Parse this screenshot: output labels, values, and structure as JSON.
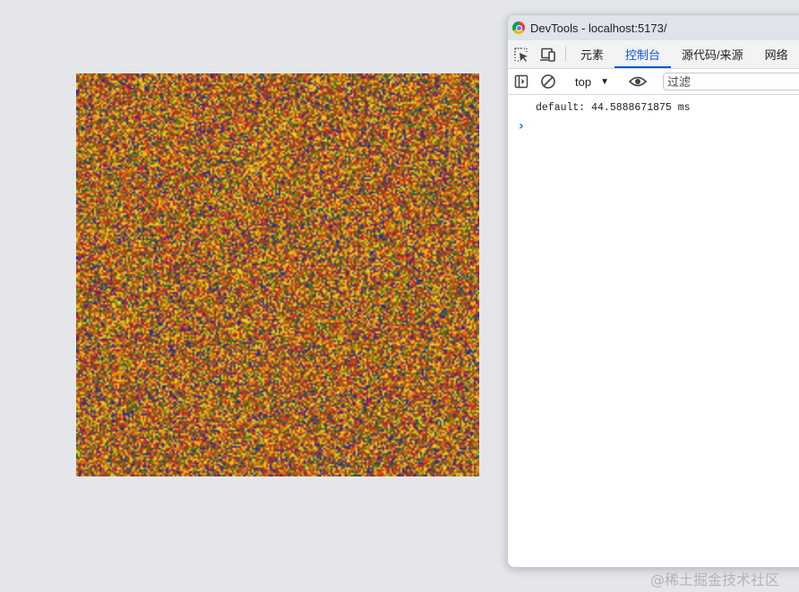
{
  "window": {
    "title": "DevTools - localhost:5173/"
  },
  "tabs": [
    {
      "label": "元素"
    },
    {
      "label": "控制台",
      "active": true
    },
    {
      "label": "源代码/来源"
    },
    {
      "label": "网络"
    }
  ],
  "toolbar": {
    "context": "top",
    "filter_placeholder": "过滤"
  },
  "console": {
    "lines": [
      "default: 44.5888671875 ms"
    ]
  },
  "icons": {
    "inspect": "inspect-element-icon",
    "device": "device-toolbar-icon",
    "sidebar": "show-sidebar-icon",
    "clear": "clear-console-icon",
    "live_expression": "eye-icon",
    "prompt": "chevron-right-icon"
  },
  "colors": {
    "page_background": "#e4e6ea",
    "active_tab": "#0b57d0",
    "prompt": "#1a73e8",
    "noise_palette": [
      "#c8321e",
      "#e0a818",
      "#f0d020",
      "#2a2a96",
      "#3a6e1e",
      "#e06a1a",
      "#b42830",
      "#8a7a1a"
    ]
  },
  "watermark": "@稀土掘金技术社区"
}
